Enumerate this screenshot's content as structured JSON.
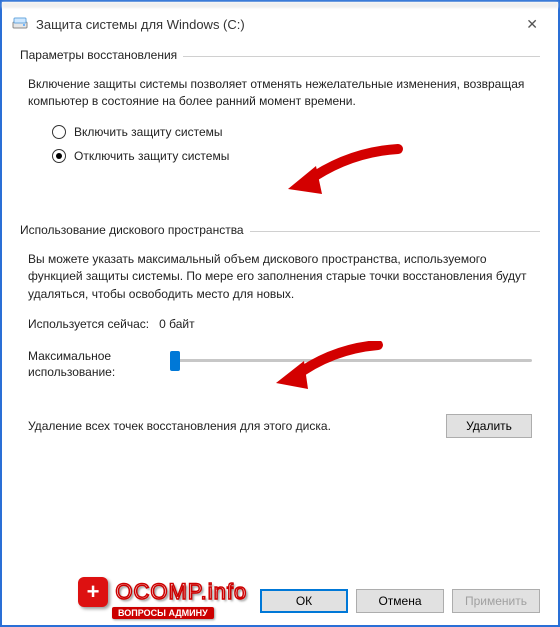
{
  "window": {
    "title": "Защита системы для Windows (C:)"
  },
  "section_restore": {
    "heading": "Параметры восстановления",
    "description": "Включение защиты системы позволяет отменять нежелательные изменения, возвращая компьютер в состояние на более ранний момент времени.",
    "option_enable": "Включить защиту системы",
    "option_disable": "Отключить защиту системы",
    "selected": "disable"
  },
  "section_disk": {
    "heading": "Использование дискового пространства",
    "description": "Вы можете указать максимальный объем дискового пространства, используемого функцией защиты системы. По мере его заполнения старые точки восстановления будут удаляться, чтобы освободить место для новых.",
    "current_label": "Используется сейчас:",
    "current_value": "0 байт",
    "max_label": "Максимальное использование:",
    "slider_value": 0
  },
  "delete": {
    "text": "Удаление всех точек восстановления для этого диска.",
    "button": "Удалить"
  },
  "buttons": {
    "ok": "ОК",
    "cancel": "Отмена",
    "apply": "Применить"
  },
  "watermark": {
    "main": "OCOMP.info",
    "sub": "ВОПРОСЫ АДМИНУ"
  }
}
